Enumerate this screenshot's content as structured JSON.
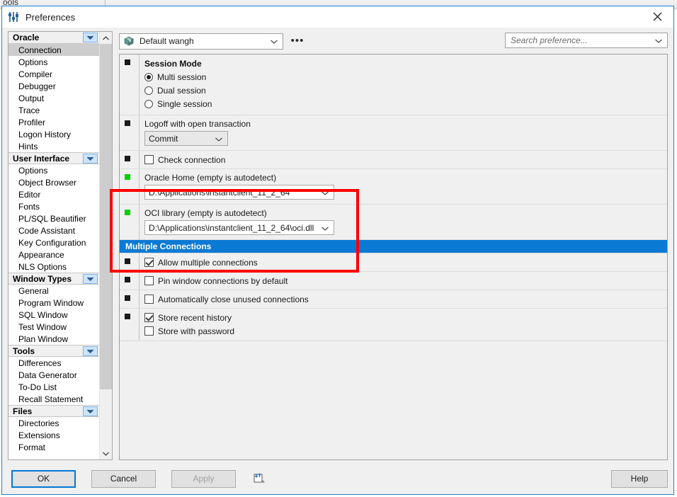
{
  "app": {
    "background_menu_text": "ools"
  },
  "window": {
    "title": "Preferences",
    "icon": "sliders-icon",
    "close_label": "×"
  },
  "sidebar": {
    "scroll_up": "▲",
    "scroll_down": "▼",
    "groups": [
      {
        "label": "Oracle",
        "items": [
          {
            "label": "Connection",
            "selected": true
          },
          {
            "label": "Options",
            "selected": false
          },
          {
            "label": "Compiler",
            "selected": false
          },
          {
            "label": "Debugger",
            "selected": false
          },
          {
            "label": "Output",
            "selected": false
          },
          {
            "label": "Trace",
            "selected": false
          },
          {
            "label": "Profiler",
            "selected": false
          },
          {
            "label": "Logon History",
            "selected": false
          },
          {
            "label": "Hints",
            "selected": false
          }
        ]
      },
      {
        "label": "User Interface",
        "items": [
          {
            "label": "Options",
            "selected": false
          },
          {
            "label": "Object Browser",
            "selected": false
          },
          {
            "label": "Editor",
            "selected": false
          },
          {
            "label": "Fonts",
            "selected": false
          },
          {
            "label": "PL/SQL Beautifier",
            "selected": false
          },
          {
            "label": "Code Assistant",
            "selected": false
          },
          {
            "label": "Key Configuration",
            "selected": false
          },
          {
            "label": "Appearance",
            "selected": false
          },
          {
            "label": "NLS Options",
            "selected": false
          }
        ]
      },
      {
        "label": "Window Types",
        "items": [
          {
            "label": "General",
            "selected": false
          },
          {
            "label": "Program Window",
            "selected": false
          },
          {
            "label": "SQL Window",
            "selected": false
          },
          {
            "label": "Test Window",
            "selected": false
          },
          {
            "label": "Plan Window",
            "selected": false
          }
        ]
      },
      {
        "label": "Tools",
        "items": [
          {
            "label": "Differences",
            "selected": false
          },
          {
            "label": "Data Generator",
            "selected": false
          },
          {
            "label": "To-Do List",
            "selected": false
          },
          {
            "label": "Recall Statement",
            "selected": false
          }
        ]
      },
      {
        "label": "Files",
        "items": [
          {
            "label": "Directories",
            "selected": false
          },
          {
            "label": "Extensions",
            "selected": false
          },
          {
            "label": "Format",
            "selected": false
          }
        ]
      }
    ]
  },
  "toolbar": {
    "profile_value": "Default wangh",
    "profile_icon": "package-box-icon",
    "more_button_label": "•••",
    "search_placeholder": "Search preference...",
    "search_value": ""
  },
  "settings": {
    "session_mode": {
      "title": "Session Mode",
      "marker": "default",
      "options": [
        {
          "label": "Multi session",
          "selected": true
        },
        {
          "label": "Dual session",
          "selected": false
        },
        {
          "label": "Single session",
          "selected": false
        }
      ]
    },
    "logoff": {
      "marker": "default",
      "label": "Logoff with open transaction",
      "value": "Commit"
    },
    "check_connection": {
      "marker": "default",
      "label": "Check connection",
      "checked": false
    },
    "oracle_home": {
      "marker": "changed",
      "label": "Oracle Home (empty is autodetect)",
      "value": "D:\\Applications\\instantclient_11_2_64"
    },
    "oci_library": {
      "marker": "changed",
      "label": "OCI library (empty is autodetect)",
      "value": "D:\\Applications\\instantclient_11_2_64\\oci.dll"
    },
    "multiple_connections_header": "Multiple Connections",
    "allow_multiple": {
      "marker": "default",
      "label": "Allow multiple connections",
      "checked": true
    },
    "pin_window": {
      "marker": "default",
      "label": "Pin window connections by default",
      "checked": false
    },
    "auto_close": {
      "marker": "default",
      "label": "Automatically close unused connections",
      "checked": false
    },
    "store_history": {
      "marker": "default",
      "label": "Store recent history",
      "checked": true,
      "sub_label": "Store with password",
      "sub_checked": false
    }
  },
  "footer": {
    "ok": "OK",
    "cancel": "Cancel",
    "apply": "Apply",
    "import_export_icon": "import-export-icon",
    "help": "Help"
  },
  "colors": {
    "accent": "#0b7ad4",
    "highlight_rect": "#ff0000",
    "marker_changed": "#00d000",
    "marker_default": "#1a1a1a"
  }
}
